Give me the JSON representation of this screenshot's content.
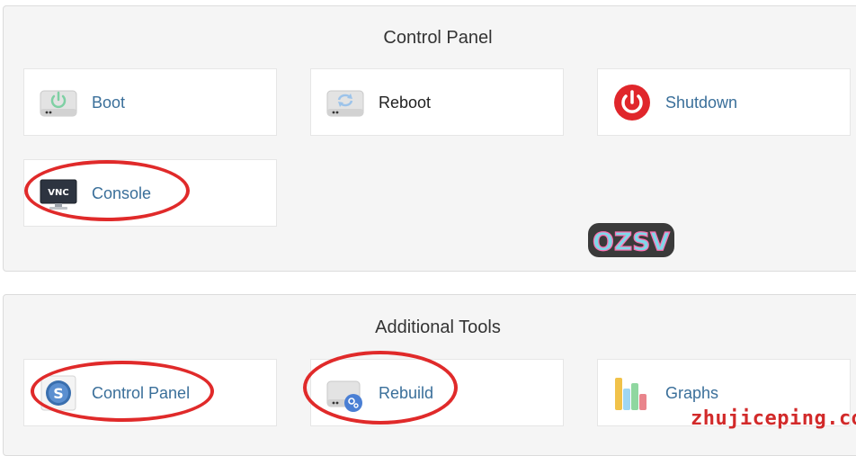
{
  "control_panel": {
    "title": "Control Panel",
    "tiles": {
      "boot": {
        "label": "Boot",
        "icon": "drive-power-icon"
      },
      "reboot": {
        "label": "Reboot",
        "icon": "drive-refresh-icon"
      },
      "shutdown": {
        "label": "Shutdown",
        "icon": "power-button-icon"
      },
      "console": {
        "label": "Console",
        "icon": "vnc-monitor-icon",
        "icon_text": "VNC"
      }
    }
  },
  "additional_tools": {
    "title": "Additional Tools",
    "tiles": {
      "control_panel": {
        "label": "Control Panel",
        "icon": "solusvm-logo-icon"
      },
      "rebuild": {
        "label": "Rebuild",
        "icon": "drive-gears-icon"
      },
      "graphs": {
        "label": "Graphs",
        "icon": "bar-graph-icon"
      }
    }
  },
  "overlays": {
    "sticker_text": "OZSV",
    "watermark": "zhujiceping.com",
    "highlight_color": "#e02a2a"
  },
  "colors": {
    "link": "#3a6f9a",
    "panel_bg": "#f5f5f5",
    "power_red": "#e0262b"
  }
}
